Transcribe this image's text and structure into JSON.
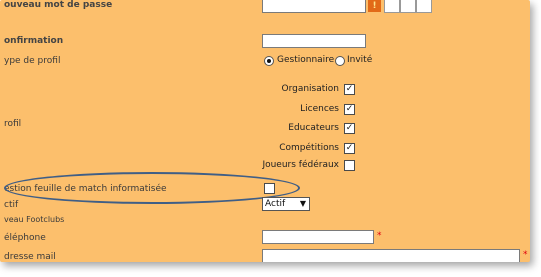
{
  "form": {
    "new_password_label": "ouveau mot de passe",
    "confirmation_label": "onfirmation",
    "profile_type_label": "ype de profil",
    "profile_types": [
      "Gestionnaire",
      "Invité"
    ],
    "profil_label": "rofil",
    "rights": [
      {
        "label": "Organisation",
        "checked": true
      },
      {
        "label": "Licences",
        "checked": true
      },
      {
        "label": "Educateurs",
        "checked": true
      },
      {
        "label": "Compétitions",
        "checked": true
      },
      {
        "label": "Joueurs fédéraux",
        "checked": false
      }
    ],
    "match_sheet_label": "estion feuille de match informatisée",
    "status_label": "ctif",
    "status_value": "Actif",
    "footclubs_label": "veau Footclubs",
    "phone_label": "éléphone",
    "email_label": "dresse mail",
    "required_mark": "*",
    "checkmark": "✓",
    "warn_glyph": "!",
    "dropdown_arrow": "▼"
  },
  "colors": {
    "background": "#fcbf6c",
    "highlight_ellipse": "#3f5e86",
    "required": "#e0000e"
  }
}
